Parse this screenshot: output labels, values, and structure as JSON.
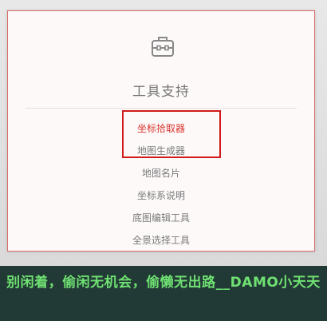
{
  "panel": {
    "title": "工具支持",
    "icon": "toolbox-icon"
  },
  "menu": {
    "items": [
      {
        "label": "坐标拾取器",
        "active": true
      },
      {
        "label": "地图生成器",
        "active": false
      },
      {
        "label": "地图名片",
        "active": false
      },
      {
        "label": "坐标系说明",
        "active": false
      },
      {
        "label": "底图编辑工具",
        "active": false
      },
      {
        "label": "全景选择工具",
        "active": false
      }
    ]
  },
  "banner": {
    "text": "别闲着，偷闲无机会，偷懒无出路__DAMO小天天"
  },
  "colors": {
    "active_link": "#d9362f",
    "highlight_border": "#d11919",
    "banner_bg": "#223a35",
    "banner_text": "#6fe072"
  }
}
